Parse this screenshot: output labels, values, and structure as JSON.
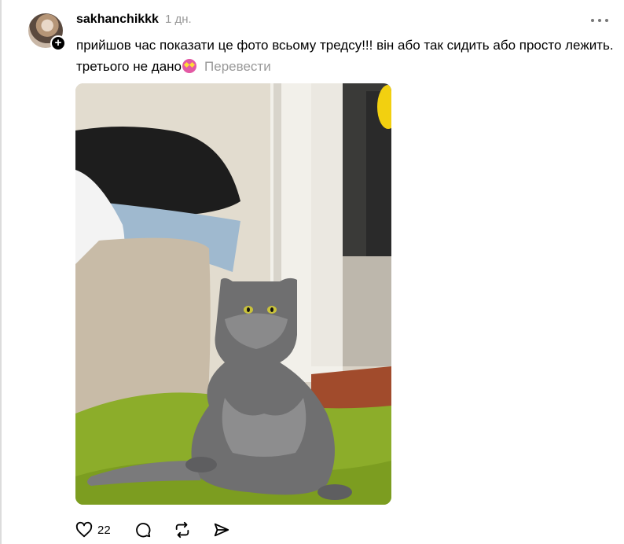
{
  "post": {
    "username": "sakhanchikkk",
    "time": "1 дн.",
    "text": "прийшов час показати це фото всьому тредсу!!! він або так сидить або просто лежить. третього не дано",
    "translate_label": "Перевести",
    "likes": "22"
  },
  "icons": {
    "more": "more-icon",
    "like": "heart-icon",
    "comment": "comment-icon",
    "repost": "repost-icon",
    "share": "share-icon",
    "emoji": "star-struck-emoji"
  },
  "colors": {
    "secondary_text": "#999999",
    "text": "#000000"
  }
}
